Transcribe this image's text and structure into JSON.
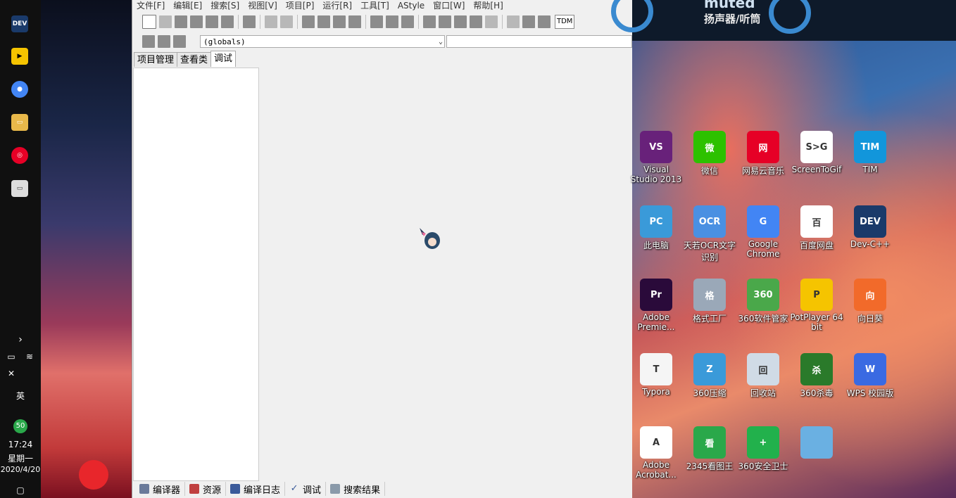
{
  "taskbar": {
    "ime_label": "英",
    "notification_badge": "50",
    "time": "17:24",
    "weekday": "星期一",
    "date": "2020/4/20"
  },
  "ide": {
    "menu": [
      "文件[F]",
      "编辑[E]",
      "搜索[S]",
      "视图[V]",
      "项目[P]",
      "运行[R]",
      "工具[T]",
      "AStyle",
      "窗口[W]",
      "帮助[H]"
    ],
    "toolbar_tdm_label": "TDM",
    "globals_value": "(globals)",
    "left_tabs": [
      "项目管理",
      "查看类",
      "调试"
    ],
    "active_left_tab": "调试",
    "bottom_tabs": [
      "编译器",
      "资源",
      "编译日志",
      "调试",
      "搜索结果"
    ]
  },
  "desktop": {
    "banner_text": "扬声器/听筒",
    "banner_partial_text": "muted",
    "icons": [
      {
        "label": "Visual Studio 2013",
        "color": "#68217a",
        "glyph": "VS"
      },
      {
        "label": "微信",
        "color": "#2dc100",
        "glyph": "微"
      },
      {
        "label": "网易云音乐",
        "color": "#e60026",
        "glyph": "网"
      },
      {
        "label": "ScreenToGif",
        "color": "#ffffff",
        "glyph": "S>G"
      },
      {
        "label": "TIM",
        "color": "#1296db",
        "glyph": "TIM"
      },
      {
        "label": "此电脑",
        "color": "#3a9ad9",
        "glyph": "PC"
      },
      {
        "label": "天若OCR文字识别",
        "color": "#4a90e2",
        "glyph": "OCR"
      },
      {
        "label": "Google Chrome",
        "color": "#4285f4",
        "glyph": "G"
      },
      {
        "label": "百度网盘",
        "color": "#ffffff",
        "glyph": "百"
      },
      {
        "label": "Dev-C++",
        "color": "#1a3a6a",
        "glyph": "DEV"
      },
      {
        "label": "Adobe Premie...",
        "color": "#2a0a3a",
        "glyph": "Pr"
      },
      {
        "label": "格式工厂",
        "color": "#9aa8b8",
        "glyph": "格"
      },
      {
        "label": "360软件管家",
        "color": "#4aa84a",
        "glyph": "360"
      },
      {
        "label": "PotPlayer 64 bit",
        "color": "#f5c400",
        "glyph": "P"
      },
      {
        "label": "向日葵",
        "color": "#f26a2a",
        "glyph": "向"
      },
      {
        "label": "Typora",
        "color": "#f5f5f5",
        "glyph": "T"
      },
      {
        "label": "360压缩",
        "color": "#3a9ad9",
        "glyph": "Z"
      },
      {
        "label": "回收站",
        "color": "#d0dbe6",
        "glyph": "回"
      },
      {
        "label": "360杀毒",
        "color": "#2a7a2a",
        "glyph": "杀"
      },
      {
        "label": "WPS 校园版",
        "color": "#3a6ae2",
        "glyph": "W"
      },
      {
        "label": "Adobe Acrobat...",
        "color": "#ffffff",
        "glyph": "A"
      },
      {
        "label": "2345看图王",
        "color": "#2aa84a",
        "glyph": "看"
      },
      {
        "label": "360安全卫士",
        "color": "#22b14c",
        "glyph": "+"
      },
      {
        "label": "",
        "color": "#6ab0e2",
        "glyph": ""
      }
    ]
  }
}
